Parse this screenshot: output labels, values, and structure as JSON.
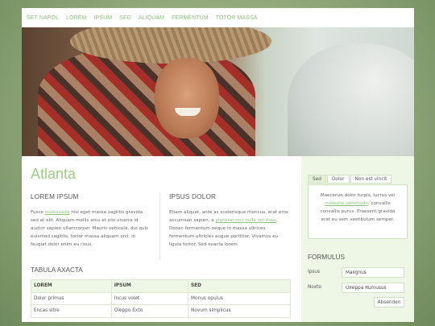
{
  "nav": {
    "items": [
      "SET NAPOL",
      "LOREM",
      "IPSUM",
      "SED",
      "ALIQUAM",
      "FERMENTUM",
      "TOTOR MASSA"
    ]
  },
  "site_title": "Atlanta",
  "col1": {
    "heading": "LOREM IPSUM",
    "text_a": "Fusce ",
    "link": "malesuada",
    "text_b": " nisi eget massa sagittis gravida sed at elit. Aliquam mollis arcu et nisi viverra id auctor sapien ullamcorper. Mauris vehicula, dui quis euismod sagittis, tortor massa aliquam orci, in feugiat dolor enim eu risus."
  },
  "col2": {
    "heading": "IPSUS DOLOR",
    "text_a": "Etiam aliquet, ante ac scelerisque rhoncus, erat eros accumsan sapien, a ",
    "link": "placerat orci nulla vel risus",
    "text_b": ". Donec fermentum neque in massa ultrices fermentum ultricies augue porttitor. Vivamus eu ligula tortor. Sed exacta lorem."
  },
  "table": {
    "title": "TABULA AXACTA",
    "headers": [
      "LOREM",
      "IPSUM",
      "SED"
    ],
    "rows": [
      [
        "Dolor primus",
        "Incus volet",
        "Monus opulus"
      ],
      [
        "Encas sitre",
        "Oleppo Exto",
        "Novum simplicus"
      ]
    ]
  },
  "sidebar": {
    "tabs": [
      "Sed",
      "Dolor",
      "Non est vincit"
    ],
    "active_tab": "Sed",
    "panel_text_a": "Maecenas dolor turpis, luctus vel ",
    "panel_link": "molestie commodo",
    "panel_text_b": ", convallis convallis purus. Praesent gravida erat eu sem vestibulum semper.",
    "form_title": "FORMULUS",
    "fields": [
      {
        "label": "Ipsus",
        "value": "Malignus"
      },
      {
        "label": "Noxto",
        "value": "Olleppa Rumusus"
      }
    ],
    "submit_label": "Absenden"
  },
  "colors": {
    "accent": "#8bc27a",
    "title": "#9ccc86",
    "sidebar_bg": "#eef6e6",
    "outer_bg": "#8fa679"
  }
}
